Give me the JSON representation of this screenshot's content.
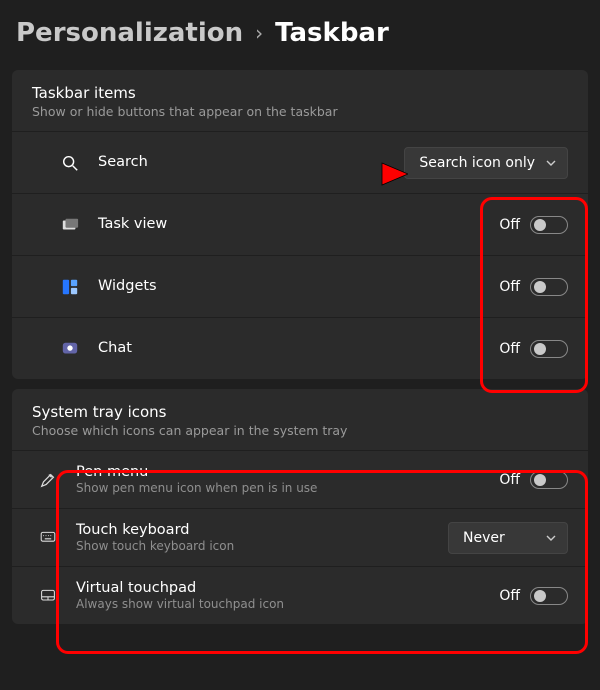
{
  "breadcrumb": {
    "parent": "Personalization",
    "current": "Taskbar"
  },
  "sections": {
    "items": {
      "title": "Taskbar items",
      "subtitle": "Show or hide buttons that appear on the taskbar",
      "search": {
        "label": "Search",
        "dropdown_value": "Search icon only"
      },
      "taskview": {
        "label": "Task view",
        "state": "Off"
      },
      "widgets": {
        "label": "Widgets",
        "state": "Off"
      },
      "chat": {
        "label": "Chat",
        "state": "Off"
      }
    },
    "tray": {
      "title": "System tray icons",
      "subtitle": "Choose which icons can appear in the system tray",
      "pen": {
        "label": "Pen menu",
        "sublabel": "Show pen menu icon when pen is in use",
        "state": "Off"
      },
      "touchkb": {
        "label": "Touch keyboard",
        "sublabel": "Show touch keyboard icon",
        "dropdown_value": "Never"
      },
      "touchpad": {
        "label": "Virtual touchpad",
        "sublabel": "Always show virtual touchpad icon",
        "state": "Off"
      }
    }
  },
  "annotations": {
    "arrow_color": "#ff0000"
  }
}
